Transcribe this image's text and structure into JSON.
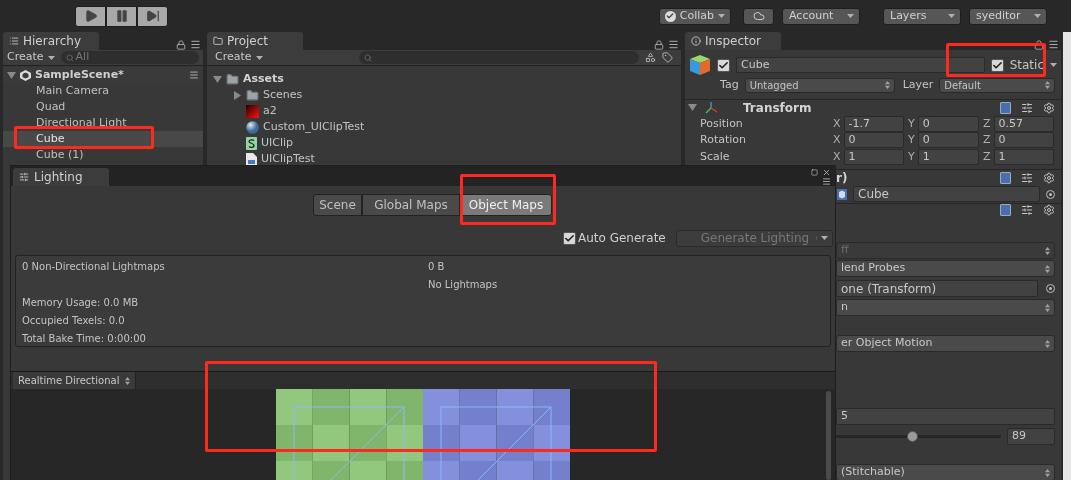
{
  "toolbar": {
    "play_controls": [
      {
        "kind": "play",
        "selected": false
      },
      {
        "kind": "pause",
        "selected": false
      },
      {
        "kind": "step",
        "selected": false
      }
    ],
    "collab": {
      "label": "Collab",
      "checked": true
    },
    "menus": [
      {
        "kind": "cloud"
      },
      {
        "kind": "menu",
        "label": "Account"
      },
      {
        "kind": "gap"
      },
      {
        "kind": "menu",
        "label": "Layers"
      },
      {
        "kind": "menu",
        "label": "syeditor"
      }
    ]
  },
  "hierarchy": {
    "tab": "Hierarchy",
    "create": "Create",
    "search_placeholder": "All",
    "scene": {
      "name": "SampleScene*",
      "expanded": true
    },
    "items": [
      {
        "label": "Main Camera",
        "selected": false
      },
      {
        "label": "Quad",
        "selected": false
      },
      {
        "label": "Directional Light",
        "selected": false
      },
      {
        "label": "Cube",
        "selected": true
      },
      {
        "label": "Cube (1)",
        "selected": false
      }
    ]
  },
  "project": {
    "tab": "Project",
    "create": "Create",
    "items": [
      {
        "kind": "folder",
        "label": "Assets",
        "expanded": true,
        "children": [
          {
            "kind": "folder",
            "label": "Scenes",
            "expanded": false
          },
          {
            "kind": "texture",
            "label": "a2"
          },
          {
            "kind": "material",
            "label": "Custom_UIClipTest"
          },
          {
            "kind": "shader",
            "label": "UIClip"
          },
          {
            "kind": "script",
            "label": "UIClipTest"
          }
        ]
      }
    ]
  },
  "inspector": {
    "tab": "Inspector",
    "object": {
      "active": true,
      "name": "Cube",
      "static": true,
      "static_label": "Static",
      "tag_label": "Tag",
      "tag": "Untagged",
      "layer_label": "Layer",
      "layer": "Default"
    },
    "transform": {
      "title": "Transform",
      "expanded": true,
      "rows": [
        {
          "label": "Position",
          "values": [
            {
              "axis": "X",
              "value": "-1.7"
            },
            {
              "axis": "Y",
              "value": "0"
            },
            {
              "axis": "Z",
              "value": "0.57"
            }
          ]
        },
        {
          "label": "Rotation",
          "values": [
            {
              "axis": "X",
              "value": "0"
            },
            {
              "axis": "Y",
              "value": "0"
            },
            {
              "axis": "Z",
              "value": "0"
            }
          ]
        },
        {
          "label": "Scale",
          "values": [
            {
              "axis": "X",
              "value": "1"
            },
            {
              "axis": "Y",
              "value": "1"
            },
            {
              "axis": "Z",
              "value": "1"
            }
          ]
        }
      ]
    },
    "mesh_filter": {
      "title": "r)",
      "mesh": "Cube"
    },
    "renderer_rows": [
      {
        "kind": "dropdown",
        "text": "ff",
        "disabled": true
      },
      {
        "kind": "dropdown",
        "text": "lend Probes",
        "disabled": false
      },
      {
        "kind": "object",
        "text": "one (Transform)"
      },
      {
        "kind": "dropdown",
        "text": "n",
        "disabled": false
      },
      {
        "kind": "dropdown",
        "text": "er Object Motion",
        "disabled": false
      },
      {
        "kind": "text",
        "text": "5"
      },
      {
        "kind": "slider",
        "level": 0.46,
        "text": "89"
      },
      {
        "kind": "dropdown",
        "text": "(Stitchable)",
        "disabled": false
      }
    ]
  },
  "lighting": {
    "tab": "Lighting",
    "modes": [
      {
        "label": "Scene",
        "selected": false
      },
      {
        "label": "Global Maps",
        "selected": false
      },
      {
        "label": "Object Maps",
        "selected": true
      }
    ],
    "auto_generate": {
      "label": "Auto Generate",
      "checked": true
    },
    "generate": {
      "label": "Generate Lighting",
      "disabled": true
    },
    "stats": {
      "left": [
        "0 Non-Directional Lightmaps",
        "Memory Usage: 0.0 MB",
        "Occupied Texels: 0.0",
        "Total Bake Time: 0:00:00"
      ],
      "right": [
        "0 B",
        "No Lightmaps"
      ]
    },
    "preview_mode": "Realtime Directional"
  }
}
